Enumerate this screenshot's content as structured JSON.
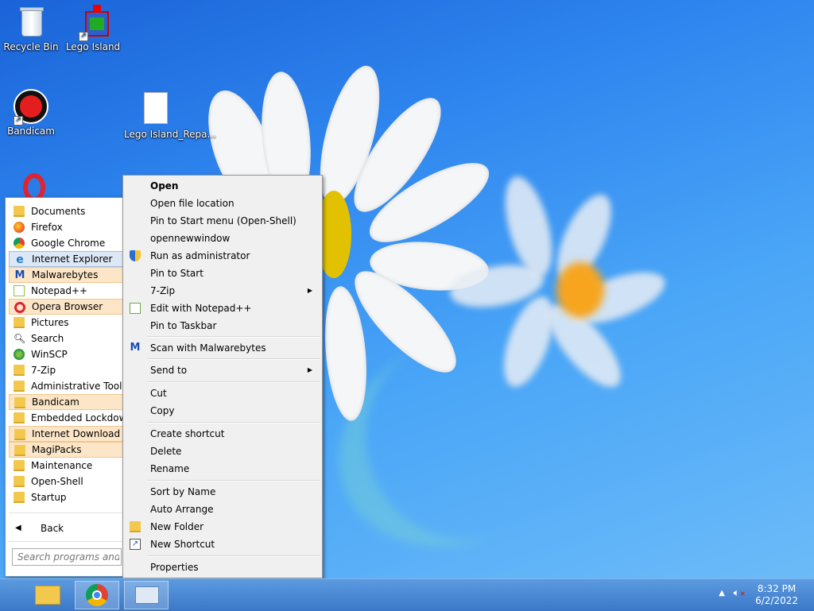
{
  "desktop": {
    "icons": [
      {
        "label": "Recycle Bin",
        "icon": "recycle-bin-icon"
      },
      {
        "label": "Lego Island",
        "icon": "lego-island-icon"
      },
      {
        "label": "Bandicam",
        "icon": "bandicam-icon"
      },
      {
        "label": "Lego Island_Repa...",
        "icon": "file-icon"
      },
      {
        "label": "",
        "icon": "opera-icon"
      }
    ]
  },
  "start_menu": {
    "items": [
      {
        "label": "Documents",
        "icon": "folder-icon"
      },
      {
        "label": "Firefox",
        "icon": "firefox-icon"
      },
      {
        "label": "Google Chrome",
        "icon": "chrome-icon"
      },
      {
        "label": "Internet Explorer",
        "icon": "ie-icon"
      },
      {
        "label": "Malwarebytes",
        "icon": "malwarebytes-icon"
      },
      {
        "label": "Notepad++",
        "icon": "notepad-plus-plus-icon"
      },
      {
        "label": "Opera Browser",
        "icon": "opera-icon"
      },
      {
        "label": "Pictures",
        "icon": "folder-icon"
      },
      {
        "label": "Search",
        "icon": "search-icon"
      },
      {
        "label": "WinSCP",
        "icon": "winscp-icon"
      },
      {
        "label": "7-Zip",
        "icon": "folder-icon"
      },
      {
        "label": "Administrative Tools",
        "icon": "folder-icon"
      },
      {
        "label": "Bandicam",
        "icon": "folder-icon"
      },
      {
        "label": "Embedded Lockdown",
        "icon": "folder-icon"
      },
      {
        "label": "Internet Download Ma",
        "icon": "folder-icon"
      },
      {
        "label": "MagiPacks",
        "icon": "folder-icon"
      },
      {
        "label": "Maintenance",
        "icon": "folder-icon"
      },
      {
        "label": "Open-Shell",
        "icon": "folder-icon"
      },
      {
        "label": "Startup",
        "icon": "folder-icon"
      }
    ],
    "back_label": "Back",
    "search_placeholder": "Search programs and file"
  },
  "context_menu": {
    "items": [
      {
        "label": "Open",
        "bold": true
      },
      {
        "label": "Open file location"
      },
      {
        "label": "Pin to Start menu (Open-Shell)"
      },
      {
        "label": "opennewwindow"
      },
      {
        "label": "Run as administrator",
        "icon": "shield-icon"
      },
      {
        "label": "Pin to Start"
      },
      {
        "label": "7-Zip",
        "submenu": true
      },
      {
        "label": "Edit with Notepad++",
        "icon": "notepad-plus-plus-icon"
      },
      {
        "label": "Pin to Taskbar"
      },
      {
        "label": "Scan with Malwarebytes",
        "icon": "malwarebytes-icon"
      },
      {
        "label": "Send to",
        "submenu": true
      },
      {
        "label": "Cut"
      },
      {
        "label": "Copy"
      },
      {
        "label": "Create shortcut"
      },
      {
        "label": "Delete"
      },
      {
        "label": "Rename"
      },
      {
        "label": "Sort by Name"
      },
      {
        "label": "Auto Arrange"
      },
      {
        "label": "New Folder",
        "icon": "folder-icon"
      },
      {
        "label": "New Shortcut",
        "icon": "shortcut-icon"
      },
      {
        "label": "Properties"
      }
    ],
    "submenu_arrow": "▶"
  },
  "taskbar": {
    "buttons": [
      {
        "name": "File Explorer",
        "icon": "file-explorer-icon"
      },
      {
        "name": "Google Chrome",
        "icon": "chrome-icon"
      },
      {
        "name": "Control Panel",
        "icon": "control-panel-icon"
      }
    ],
    "time": "8:32 PM",
    "date": "6/2/2022"
  }
}
